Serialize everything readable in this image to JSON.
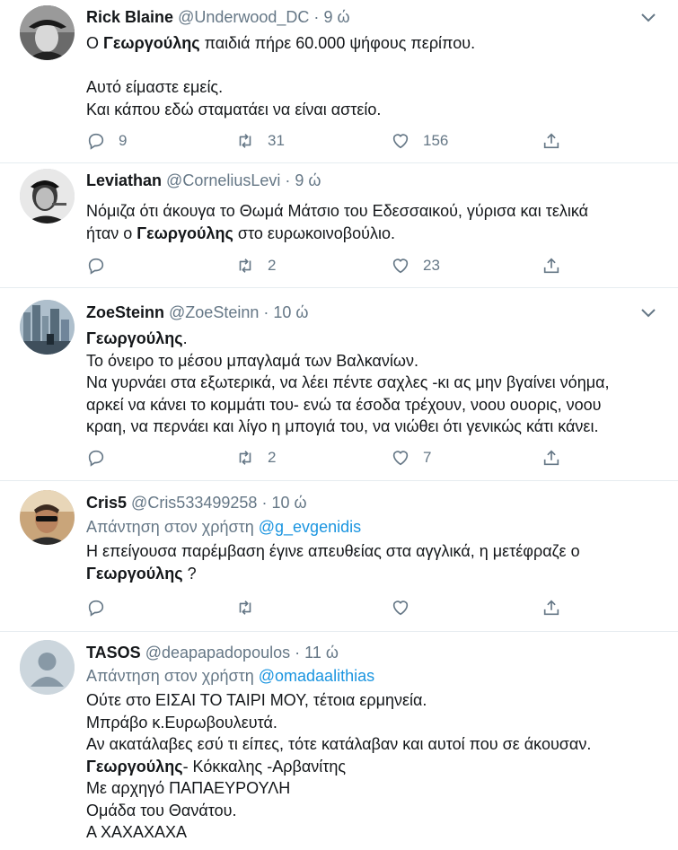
{
  "tweets": [
    {
      "name": "Rick Blaine",
      "handle": "@Underwood_DC",
      "time": "9 ώ",
      "avatar": "avatar-photo-hat-man",
      "lines": [
        [
          {
            "t": "Ο "
          },
          {
            "t": "Γεωργούλης",
            "b": true
          },
          {
            "t": " παιδιά πήρε 60.000 ψήφους περίπου."
          }
        ],
        [],
        [
          {
            "t": "Αυτό είμαστε εμείς."
          }
        ],
        [
          {
            "t": "Και κάπου εδώ σταματάει να είναι αστείο."
          }
        ]
      ],
      "replies": "9",
      "retweets": "31",
      "likes": "156"
    },
    {
      "name": "Leviathan",
      "handle": "@CorneliusLevi",
      "time": "9 ώ",
      "avatar": "avatar-photo-smoking-man",
      "lines": [
        [
          {
            "t": "Νόμιζα ότι άκουγα το Θωμά Μάτσιο του Εδεσσαικού, γύρισα και  τελικά"
          }
        ],
        [
          {
            "t": "ήταν ο "
          },
          {
            "t": "Γεωργούλης",
            "b": true
          },
          {
            "t": " στο ευρωκοινοβούλιο."
          }
        ]
      ],
      "replies": "",
      "retweets": "2",
      "likes": "23"
    },
    {
      "name": "ZoeSteinn",
      "handle": "@ZoeSteinn",
      "time": "10 ώ",
      "avatar": "avatar-photo-city",
      "lines": [
        [
          {
            "t": "Γεωργούλης",
            "b": true
          },
          {
            "t": "."
          }
        ],
        [
          {
            "t": "Το όνειρο το μέσου μπαγλαμά των Βαλκανίων."
          }
        ],
        [
          {
            "t": "Να γυρνάει στα εξωτερικά, να λέει πέντε σαχλες -κι ας μην βγαίνει νόημα,"
          }
        ],
        [
          {
            "t": "αρκεί να κάνει το κομμάτι του- ενώ τα έσοδα τρέχουν, νοου ουορις, νοου"
          }
        ],
        [
          {
            "t": "κραη, να περνάει και λίγο η μπογιά του, να νιώθει ότι γενικώς κάτι κάνει."
          }
        ]
      ],
      "replies": "",
      "retweets": "2",
      "likes": "7"
    },
    {
      "name": "Cris5",
      "handle": "@Cris533499258",
      "time": "10 ώ",
      "avatar": "avatar-photo-man-sunglasses",
      "reply_label": "Απάντηση στον χρήστη",
      "reply_to": "@g_evgenidis",
      "lines": [
        [
          {
            "t": "Η επείγουσα παρέμβαση έγινε απευθείας  στα αγγλικά, η μετέφραζε ο"
          }
        ],
        [
          {
            "t": "Γεωργούλης",
            "b": true
          },
          {
            "t": " ?"
          }
        ]
      ],
      "replies": "",
      "retweets": "",
      "likes": ""
    },
    {
      "name": "TASOS",
      "handle": "@deapapadopoulos",
      "time": "11 ώ",
      "avatar": "default-avatar-icon",
      "reply_label": "Απάντηση στον χρήστη",
      "reply_to": "@omadaalithias",
      "lines": [
        [
          {
            "t": "Ούτε στο ΕΙΣΑΙ ΤΟ ΤΑΙΡΙ ΜΟΥ, τέτοια ερμηνεία."
          }
        ],
        [
          {
            "t": "Μπράβο κ.Ευρωβουλευτά."
          }
        ],
        [
          {
            "t": "Αν ακατάλαβες εσύ τι είπες, τότε κατάλαβαν και αυτοί που σε άκουσαν."
          }
        ],
        [
          {
            "t": "Γεωργούλης",
            "b": true
          },
          {
            "t": "- Κόκκαλης -Αρβανίτης"
          }
        ],
        [
          {
            "t": "Με αρχηγό ΠΑΠΑΕΥΡΟΥΛΗ"
          }
        ],
        [
          {
            "t": "Ομάδα του Θανάτου."
          }
        ],
        [
          {
            "t": "Α ΧΑΧΑΧΑΧΑ"
          }
        ]
      ],
      "replies": null,
      "retweets": null,
      "likes": null
    }
  ],
  "colors": {
    "text": "#14171a",
    "secondary": "#657786",
    "link": "#1b95e0",
    "divider": "#e6ecf0"
  },
  "icons": [
    "reply-icon",
    "retweet-icon",
    "like-icon",
    "share-icon",
    "caret-down-icon"
  ]
}
